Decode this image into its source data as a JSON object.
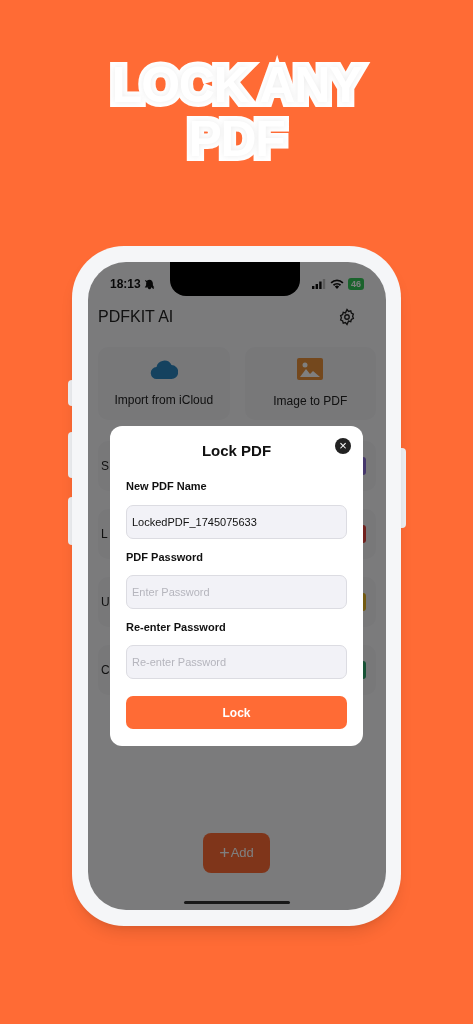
{
  "headline": [
    "LOCK ANY",
    "PDF"
  ],
  "status_bar": {
    "time": "18:13",
    "battery": "46"
  },
  "app": {
    "title": "PDFKIT AI"
  },
  "cards": [
    {
      "kind": "cloud",
      "label": "Import from iCloud"
    },
    {
      "kind": "image",
      "label": "Image to PDF"
    }
  ],
  "rows": [
    {
      "text": "S",
      "color": "#45376b"
    },
    {
      "text": "L",
      "color": "#70201d"
    },
    {
      "text": "U",
      "color": "#735a11"
    },
    {
      "text": "C",
      "color": "#175135"
    }
  ],
  "add_button": {
    "icon": "+",
    "label": "Add"
  },
  "dialog": {
    "title": "Lock PDF",
    "close": "×",
    "fields": [
      {
        "label": "New PDF Name",
        "value": "LockedPDF_1745075633"
      },
      {
        "label": "PDF Password",
        "placeholder": "Enter Password"
      },
      {
        "label": "Re-enter Password",
        "placeholder": "Re-enter Password"
      }
    ],
    "button": "Lock"
  }
}
